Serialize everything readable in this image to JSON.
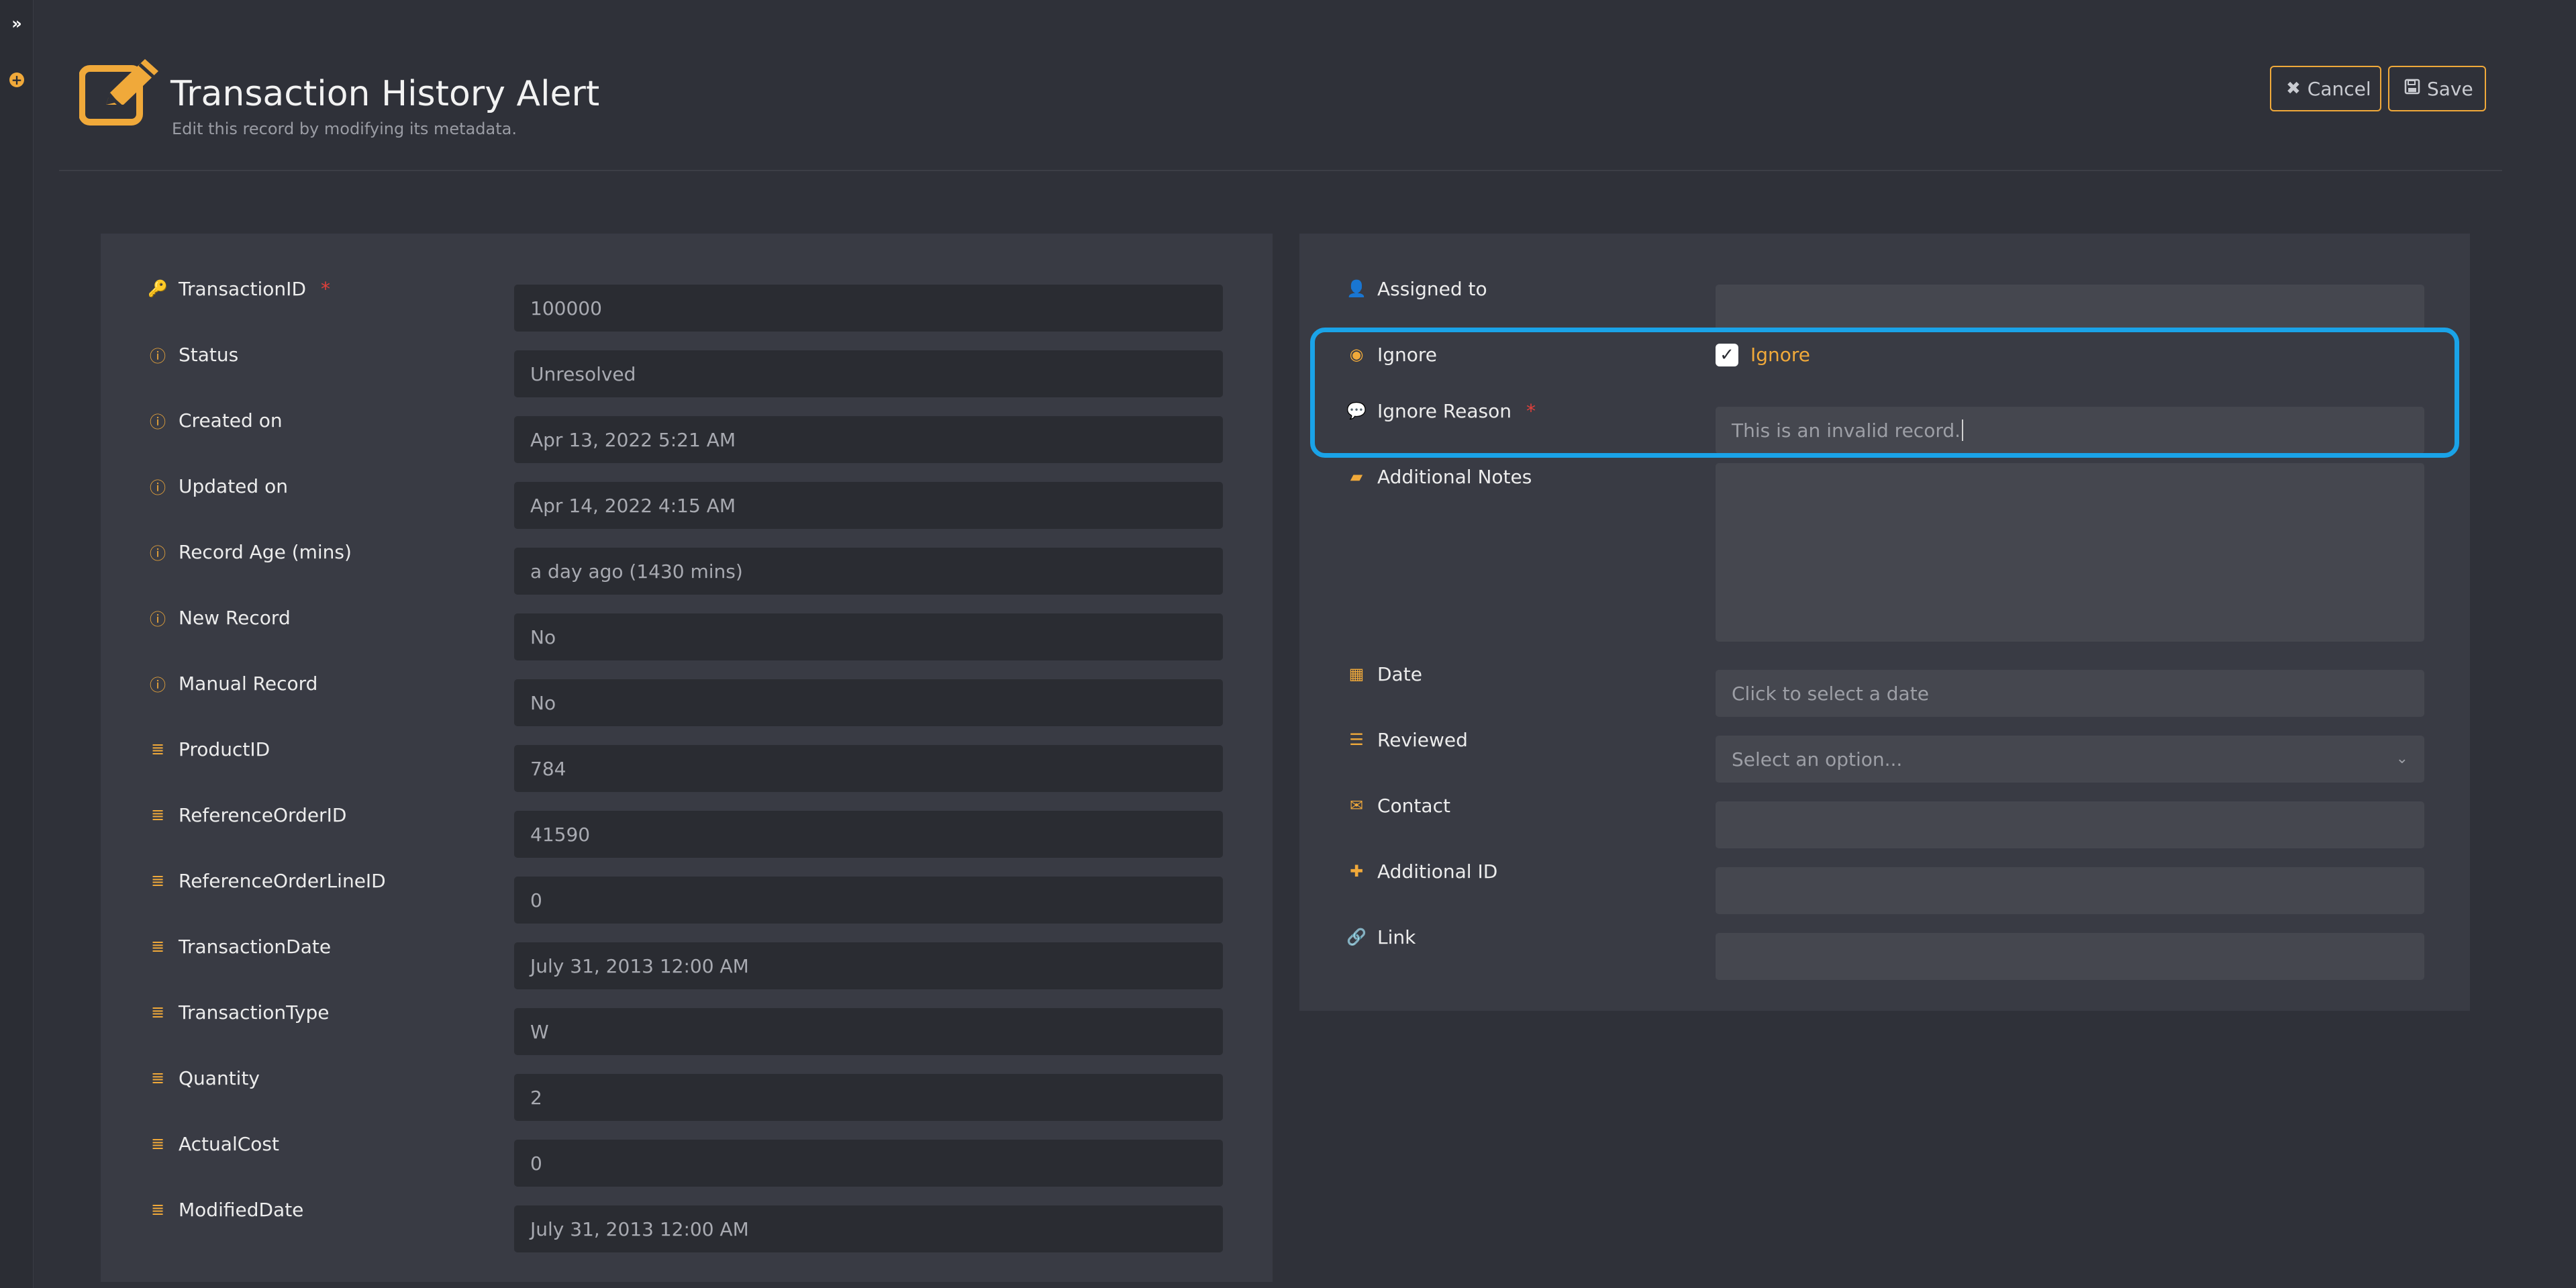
{
  "header": {
    "title": "Transaction History Alert",
    "subtitle": "Edit this record by modifying its metadata.",
    "cancel_label": "Cancel",
    "save_label": "Save"
  },
  "colors": {
    "accent": "#f0a93a",
    "highlight": "#1aa3e8",
    "required": "#e2403b"
  },
  "left_fields": [
    {
      "label": "TransactionID",
      "value": "100000",
      "icon": "key-icon"
    },
    {
      "label": "Status",
      "value": "Unresolved",
      "icon": "info-icon"
    },
    {
      "label": "Created on",
      "value": "Apr 13, 2022 5:21 AM",
      "icon": "info-icon"
    },
    {
      "label": "Updated on",
      "value": "Apr 14, 2022 4:15 AM",
      "icon": "info-icon"
    },
    {
      "label": "Record Age (mins)",
      "value": "a day ago (1430 mins)",
      "icon": "info-icon"
    },
    {
      "label": "New Record",
      "value": "No",
      "icon": "info-icon"
    },
    {
      "label": "Manual Record",
      "value": "No",
      "icon": "info-icon"
    },
    {
      "label": "ProductID",
      "value": "784",
      "icon": "database-icon"
    },
    {
      "label": "ReferenceOrderID",
      "value": "41590",
      "icon": "database-icon"
    },
    {
      "label": "ReferenceOrderLineID",
      "value": "0",
      "icon": "database-icon"
    },
    {
      "label": "TransactionDate",
      "value": "July 31, 2013 12:00 AM",
      "icon": "database-icon"
    },
    {
      "label": "TransactionType",
      "value": "W",
      "icon": "database-icon"
    },
    {
      "label": "Quantity",
      "value": "2",
      "icon": "database-icon"
    },
    {
      "label": "ActualCost",
      "value": "0",
      "icon": "database-icon"
    },
    {
      "label": "ModifiedDate",
      "value": "July 31, 2013 12:00 AM",
      "icon": "database-icon"
    }
  ],
  "right": {
    "assigned_to": {
      "label": "Assigned to",
      "value": ""
    },
    "ignore": {
      "label": "Ignore",
      "checkbox_label": "Ignore",
      "checked": true
    },
    "ignore_reason": {
      "label": "Ignore Reason",
      "value": "This is an invalid record."
    },
    "additional_notes": {
      "label": "Additional Notes",
      "value": ""
    },
    "date": {
      "label": "Date",
      "placeholder": "Click to select a date"
    },
    "reviewed": {
      "label": "Reviewed",
      "placeholder": "Select an option..."
    },
    "contact": {
      "label": "Contact",
      "value": ""
    },
    "additional_id": {
      "label": "Additional ID",
      "value": ""
    },
    "link": {
      "label": "Link",
      "value": ""
    }
  }
}
